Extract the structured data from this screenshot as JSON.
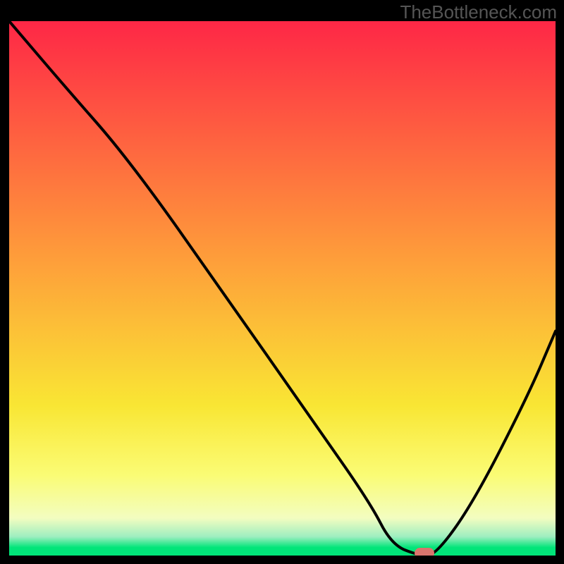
{
  "watermark": "TheBottleneck.com",
  "colors": {
    "top": "#fe2746",
    "mid_upper": "#fe9f3a",
    "mid": "#f9e634",
    "mid_lower": "#fafc75",
    "pale": "#f3fdc0",
    "green_light": "#7cecae",
    "green": "#01e579",
    "curve": "#000000",
    "marker": "#d9756d",
    "frame": "#000000"
  },
  "chart_data": {
    "type": "line",
    "title": "",
    "xlabel": "",
    "ylabel": "",
    "xlim": [
      0,
      100
    ],
    "ylim": [
      0,
      100
    ],
    "series": [
      {
        "name": "curve",
        "x": [
          0,
          10,
          22,
          40,
          55,
          66,
          70,
          75,
          78,
          85,
          95,
          100
        ],
        "y": [
          100,
          88,
          74,
          48,
          26,
          10,
          2,
          0,
          0,
          10,
          30,
          42
        ]
      }
    ],
    "marker": {
      "x": 76,
      "y": 0.5,
      "w": 3.5,
      "h": 2
    },
    "gradient_stops": [
      {
        "offset": 0,
        "color": "#fe2746"
      },
      {
        "offset": 0.45,
        "color": "#fe9f3a"
      },
      {
        "offset": 0.72,
        "color": "#f9e634"
      },
      {
        "offset": 0.85,
        "color": "#fafc75"
      },
      {
        "offset": 0.93,
        "color": "#f3fdc0"
      },
      {
        "offset": 0.965,
        "color": "#9deec0"
      },
      {
        "offset": 0.985,
        "color": "#01e579"
      },
      {
        "offset": 1.0,
        "color": "#01e579"
      }
    ]
  }
}
